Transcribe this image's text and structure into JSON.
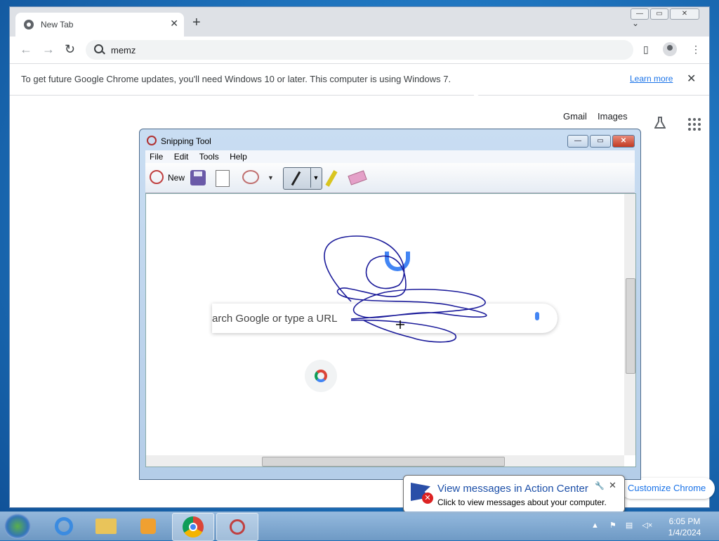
{
  "chrome": {
    "tab_title": "New Tab",
    "tab_close": "✕",
    "new_tab": "+",
    "address": "memz",
    "infobar": {
      "message": "To get future Google Chrome updates, you'll need Windows 10 or later. This computer is using Windows 7.",
      "learn_more": "Learn more",
      "close": "✕"
    },
    "ntp": {
      "gmail": "Gmail",
      "images": "Images",
      "customize": "Customize Chrome"
    }
  },
  "snipping_tool": {
    "title": "Snipping Tool",
    "menu": [
      "File",
      "Edit",
      "Tools",
      "Help"
    ],
    "new_label": "New",
    "captured": {
      "search_text": "arch Google or type a URL"
    }
  },
  "notification": {
    "title": "View messages in Action Center",
    "subtitle": "Click to view messages about your computer."
  },
  "taskbar": {
    "time": "6:05 PM",
    "date": "1/4/2024"
  }
}
